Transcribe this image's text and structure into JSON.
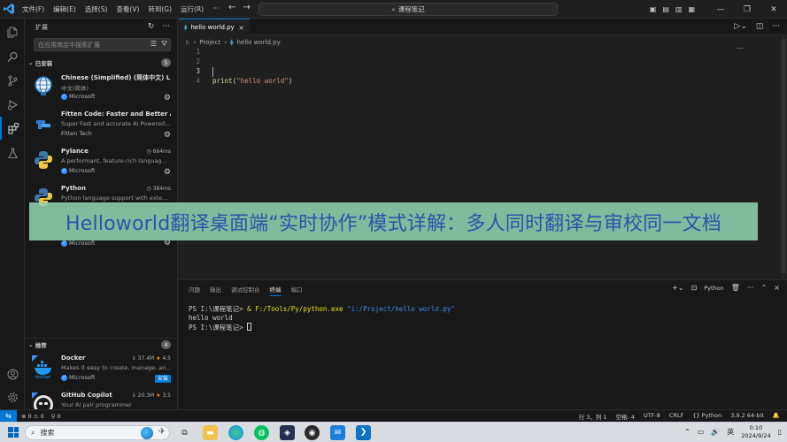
{
  "titlebar": {
    "menu": [
      "文件(F)",
      "编辑(E)",
      "选择(S)",
      "查看(V)",
      "转到(G)",
      "运行(R)",
      "···"
    ],
    "command_center": "课程笔记",
    "window_buttons": [
      "—",
      "❐",
      "✕"
    ]
  },
  "sidebar": {
    "title": "扩展",
    "search_placeholder": "在应用商店中搜索扩展",
    "installed": {
      "label": "已安装",
      "count": "5",
      "items": [
        {
          "name": "Chinese (Simplified) (简体中文) L...",
          "desc": "中文(简体)",
          "publisher": "Microsoft",
          "verified": true
        },
        {
          "name": "Fitten Code: Faster and Better AI ...",
          "desc": "Super Fast and accurate AI Powered...",
          "publisher": "Fitten Tech",
          "verified": false
        },
        {
          "name": "Pylance",
          "stat": "664ms",
          "desc": "A performant, feature-rich languag...",
          "publisher": "Microsoft",
          "verified": true
        },
        {
          "name": "Python",
          "stat": "384ms",
          "desc": "Python language support with exte...",
          "publisher": "",
          "verified": false
        },
        {
          "name": "",
          "desc": "",
          "publisher": "Microsoft",
          "verified": true
        }
      ]
    },
    "recommended": {
      "label": "推荐",
      "count": "4",
      "items": [
        {
          "name": "Docker",
          "downloads": "37.4M",
          "rating": "4.5",
          "desc": "Makes it easy to create, manage, an...",
          "publisher": "Microsoft",
          "install_label": "安装"
        },
        {
          "name": "GitHub Copilot",
          "downloads": "20.3M",
          "rating": "3.5",
          "desc": "Your AI pair programmer"
        }
      ]
    }
  },
  "editor": {
    "tab_label": "hello world.py",
    "breadcrumb": [
      "I:",
      "Project",
      "hello world.py"
    ],
    "line_numbers": [
      "1",
      "2",
      "3",
      "4"
    ],
    "code": {
      "fn": "print",
      "open": "(",
      "str": "\"hello world\"",
      "close": ")"
    }
  },
  "panel": {
    "tabs": [
      "问题",
      "输出",
      "调试控制台",
      "终端",
      "端口"
    ],
    "active_tab": "终端",
    "shell_label": "Python",
    "terminal": {
      "line1_prompt": "PS I:\\课程笔记> ",
      "line1_amp": "& ",
      "line1_exe": "F:/Tools/Py/python.exe ",
      "line1_arg": "\"i:/Project/hello world.py\"",
      "line2": "hello world",
      "line3_prompt": "PS I:\\课程笔记> "
    }
  },
  "overlay_banner": "Helloworld翻译桌面端“实时协作”模式详解：多人同时翻译与审校同一文档",
  "statusbar": {
    "errors": "⊗ 0 ⚠ 0",
    "ports": "⚲ 0",
    "position": "行 3，列 1",
    "spaces": "空格: 4",
    "encoding": "UTF-8",
    "eol": "CRLF",
    "language": "{} Python",
    "interpreter": "3.9.2 64-bit"
  },
  "taskbar": {
    "search_label": "搜索",
    "ime": "英",
    "time": "0:10",
    "date": "2024/9/24"
  },
  "colors": {
    "accent": "#0078d4",
    "banner_bg": "#8ed1b0",
    "banner_text": "#2a55a8"
  }
}
